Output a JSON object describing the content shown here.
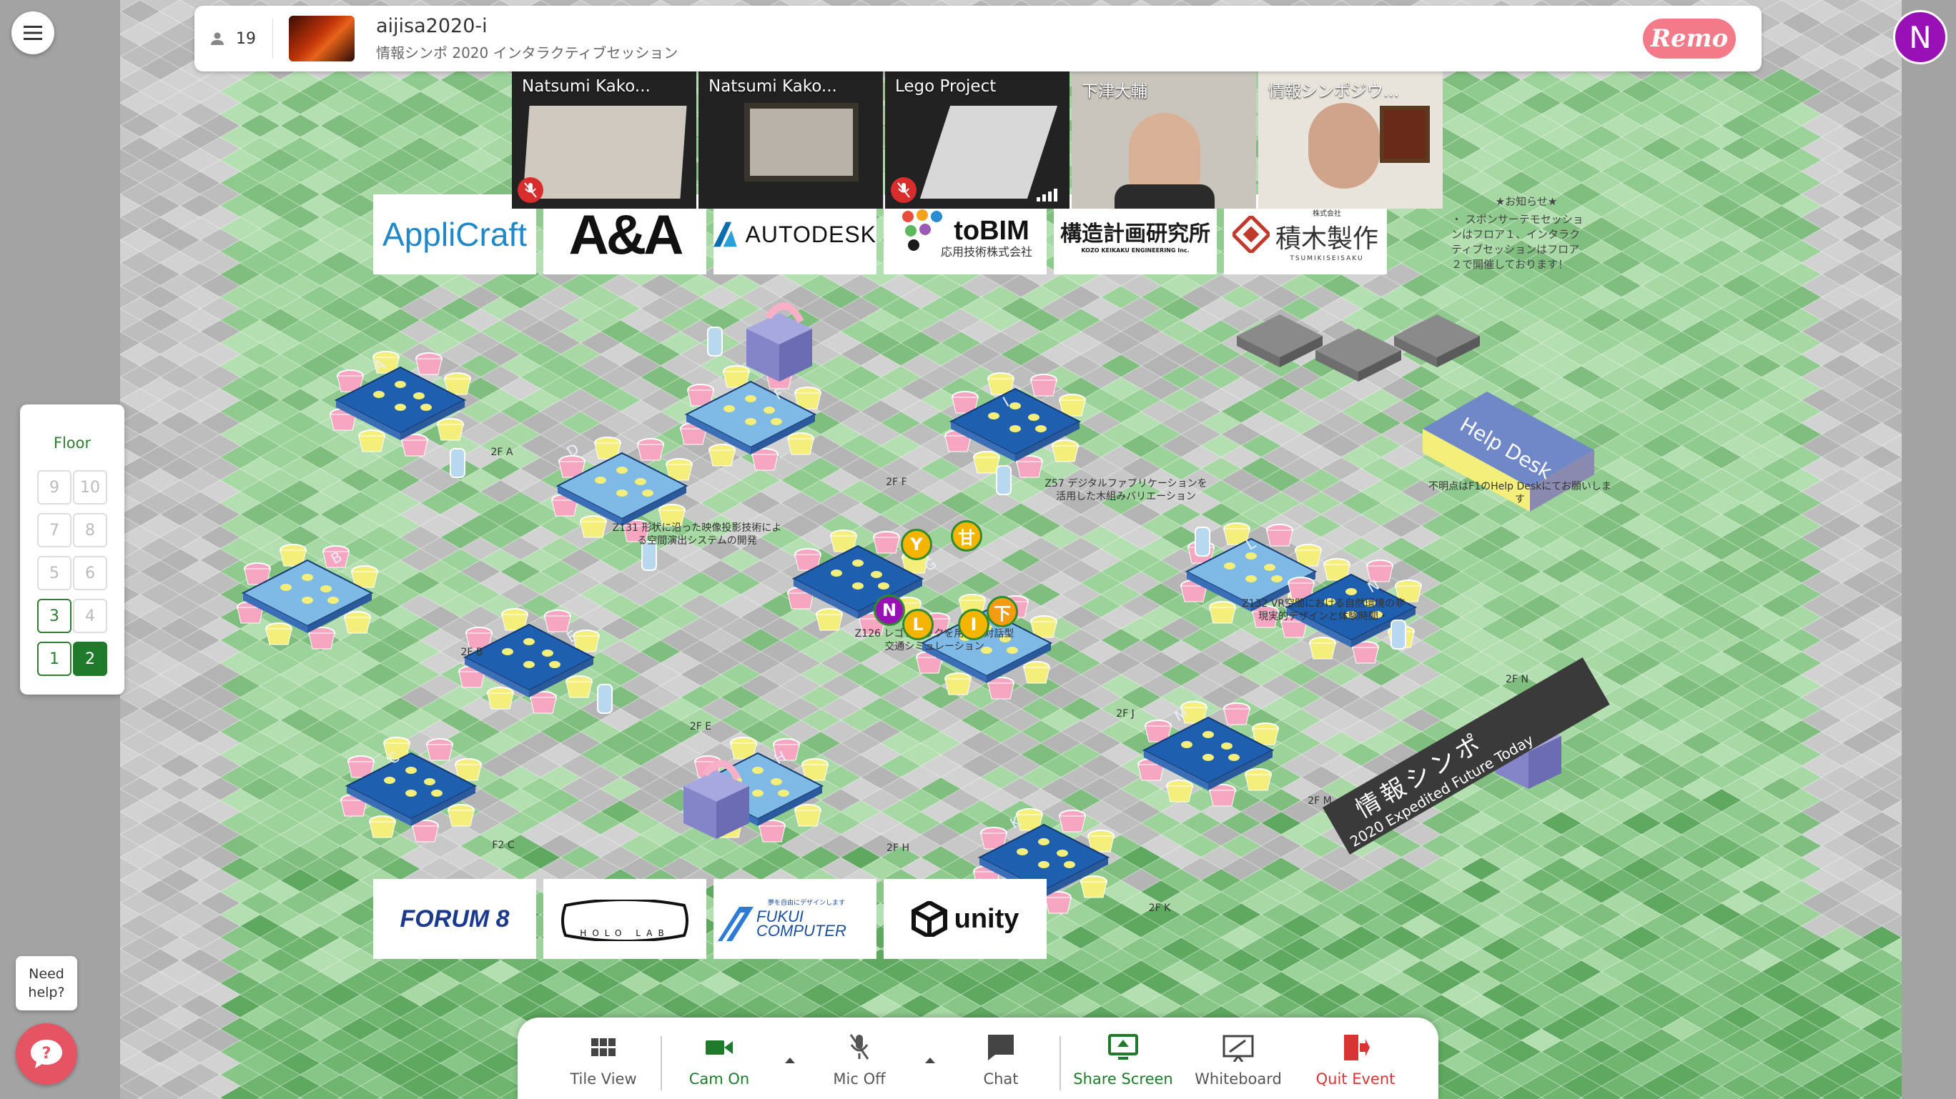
{
  "event": {
    "attendee_count": "19",
    "title": "aijisa2020-i",
    "subtitle": "情報シンポ 2020 インタラクティブセッション",
    "brand_logo_text": "Remo"
  },
  "me": {
    "avatar_initial": "N",
    "avatar_color": "#9a10b7"
  },
  "videos": [
    {
      "name": "Natsumi Kako...",
      "muted": true
    },
    {
      "name": "Natsumi Kako...",
      "muted": false
    },
    {
      "name": "Lego Project",
      "muted": true
    },
    {
      "name": "下津大輔",
      "muted": false
    },
    {
      "name": "情報シンポジウ...",
      "muted": false
    }
  ],
  "floor": {
    "title": "Floor",
    "buttons": [
      "9",
      "10",
      "7",
      "8",
      "5",
      "6",
      "3",
      "4",
      "1",
      "2"
    ],
    "active": "2"
  },
  "help": {
    "need_help_line1": "Need",
    "need_help_line2": "help?"
  },
  "toolbar": {
    "tile_view": "Tile View",
    "cam_on": "Cam On",
    "mic_off": "Mic Off",
    "chat": "Chat",
    "share_screen": "Share Screen",
    "whiteboard": "Whiteboard",
    "quit_event": "Quit Event"
  },
  "sponsors_top": [
    "AppliCraft",
    "A&A",
    "AUTODESK",
    "toBIM",
    "構造計画研究所",
    "積木製作"
  ],
  "sponsor_sub": {
    "tobim": "応用技術株式会社",
    "kozo": "KOZO KEIKAKU ENGINEERING Inc.",
    "tsumiki_small": "株式会社",
    "tsumiki_roman": "TSUMIKISEISAKU"
  },
  "sponsors_bottom": [
    "FORUM 8",
    "HOLO LAB",
    "FUKUI COMPUTER",
    "unity"
  ],
  "fukui_tagline": "夢を自由にデザインします",
  "notice": {
    "title": "★お知らせ★",
    "body": "・ スポンサーテモセッションはフロア１、インタラクティブセッションはフロア２で開催しております！"
  },
  "help_desk": {
    "sign": "Help Desk",
    "note": "不明点はF1のHelp Deskにてお願いします"
  },
  "table_labels": {
    "a": "2F A",
    "b": "2F B",
    "c": "F2 C",
    "e": "2F E",
    "f": "2F F",
    "h": "2F H",
    "j": "2F J",
    "k": "2F K",
    "m": "2F M",
    "n": "2F N",
    "d_desc": "Z131 形状に沿った映像投影技術による空間演出システムの開発",
    "i_desc": "Z57 デジタルファブリケーションを活用した木組みバリエーション",
    "g_desc": "Z126 レゴブロックを用いた対話型交通シミュレーション",
    "l_desc": "Z132 VR空間における自然環境の非現実的デザインと体験時間・"
  },
  "table_letters": [
    "A",
    "B",
    "C",
    "D",
    "E",
    "F",
    "G",
    "H",
    "I",
    "J",
    "K",
    "L",
    "M",
    "N"
  ],
  "pins": [
    {
      "letter": "Y",
      "color": "#f4b400"
    },
    {
      "letter": "甘",
      "color": "#f4b400"
    },
    {
      "letter": "N",
      "color": "#9a10b7"
    },
    {
      "letter": "L",
      "color": "#f4b400"
    },
    {
      "letter": "I",
      "color": "#f4b400"
    },
    {
      "letter": "下",
      "color": "#f39c12"
    }
  ],
  "banner": {
    "line1": "情報シンポ",
    "line2": "2020 Expedited Future Today"
  },
  "colors": {
    "accent_green": "#1f7a2c",
    "danger": "#d93434",
    "table_dark": "#1f5fb0",
    "table_light": "#7fb9e6"
  }
}
